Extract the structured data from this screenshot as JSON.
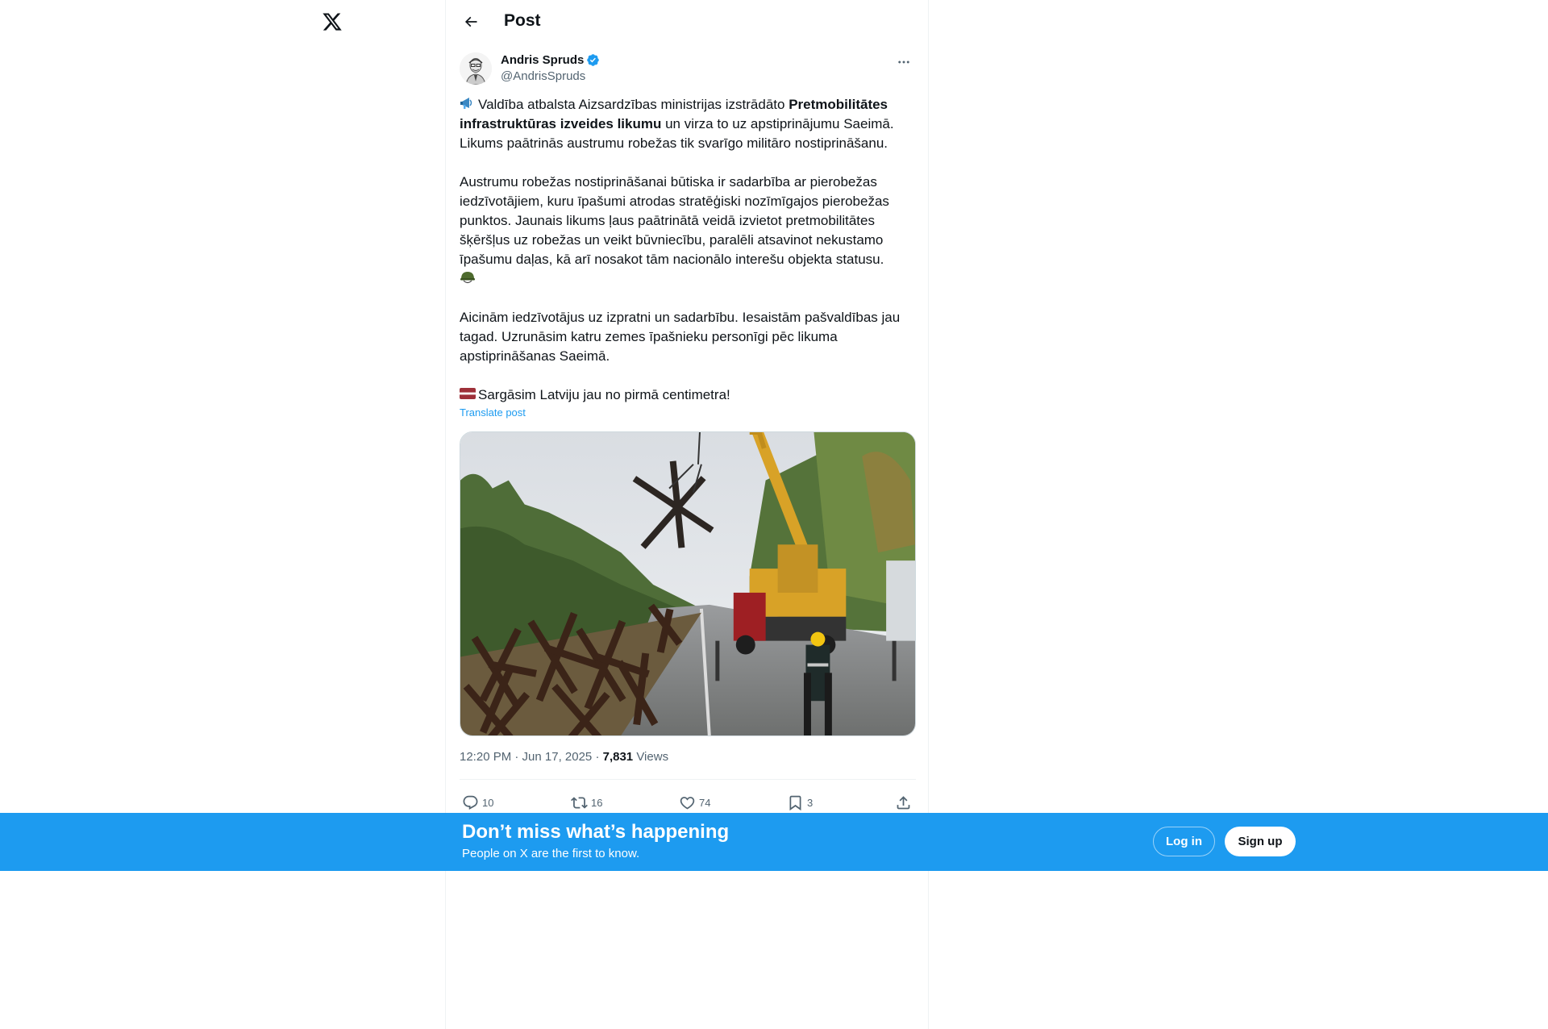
{
  "header": {
    "title": "Post"
  },
  "post": {
    "author_name": "Andris Spruds",
    "handle": "@AndrisSpruds",
    "paragraph1_pre": "Valdība atbalsta Aizsardzības ministrijas izstrādāto ",
    "paragraph1_bold": "Pretmobilitātes infrastruktūras izveides likumu",
    "paragraph1_post": " un virza to uz apstiprinājumu Saeimā. Likums paātrinās austrumu robežas tik svarīgo militāro nostiprināšanu.",
    "paragraph2": "Austrumu robežas nostiprināšanai būtiska ir sadarbība ar pierobežas iedzīvotājiem, kuru īpašumi atrodas stratēģiski nozīmīgajos pierobežas punktos. Jaunais likums ļaus paātrinātā veidā izvietot pretmobilitātes šķēršļus uz robežas un veikt būvniecību, paralēli atsavinot nekustamo īpašumu daļas, kā arī nosakot tām nacionālo interešu objekta statusu.",
    "paragraph3": "Aicinām iedzīvotājus uz izpratni un sadarbību. Iesaistām pašvaldības jau tagad. Uzrunāsim katru zemes īpašnieku personīgi pēc likuma apstiprināšanas Saeimā.",
    "paragraph4": "Sargāsim Latviju jau no pirmā centimetra!",
    "translate_label": "Translate post",
    "time": "12:20 PM · Jun 17, 2025 · ",
    "views_count": "7,831",
    "views_label": " Views",
    "stats": {
      "replies": "10",
      "reposts": "16",
      "likes": "74",
      "bookmarks": "3"
    }
  },
  "banner": {
    "title": "Don’t miss what’s happening",
    "subtitle": "People on X are the first to know.",
    "login_label": "Log in",
    "signup_label": "Sign up"
  },
  "icons": {
    "logo": "x-logo-icon",
    "back": "back-arrow-icon",
    "more": "more-icon",
    "verified": "verified-badge-icon",
    "reply": "reply-icon",
    "repost": "repost-icon",
    "like": "like-icon",
    "bookmark": "bookmark-icon",
    "share": "share-icon"
  },
  "colors": {
    "accent": "#1d9bf0",
    "text": "#0f1419",
    "secondary": "#536471",
    "border": "#eff3f4"
  }
}
